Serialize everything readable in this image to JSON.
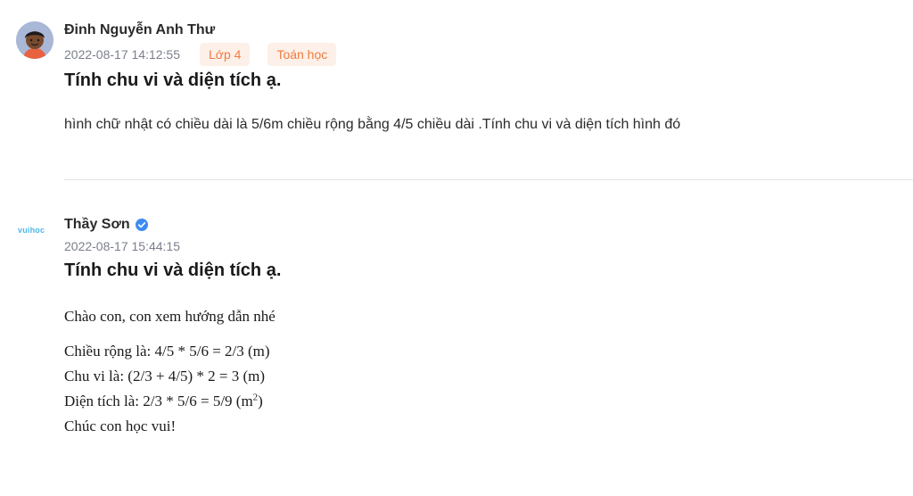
{
  "question": {
    "author": "Đinh Nguyễn Anh Thư",
    "timestamp": "2022-08-17 14:12:55",
    "tags": [
      "Lớp 4",
      "Toán học"
    ],
    "title": "Tính chu vi và diện tích ạ.",
    "body": "hình chữ nhật có chiều dài là 5/6m chiều rộng bằng 4/5 chiều dài .Tính chu vi và diện tích hình đó",
    "avatar_icon": "student-avatar-icon"
  },
  "answer": {
    "logo_text": "vuihoc",
    "author": "Thầy Sơn",
    "verified_icon": "verified-check-icon",
    "timestamp": "2022-08-17 15:44:15",
    "title": "Tính chu vi và diện tích ạ.",
    "greeting": "Chào con, con xem hướng dẫn nhé",
    "width_line": "Chiều rộng là: 4/5 * 5/6 = 2/3 (m)",
    "perimeter_line": "Chu vi là: (2/3 + 4/5) * 2 = 3 (m)",
    "area_line_prefix": "Diện tích là: 2/3 * 5/6 = 5/9 (m",
    "area_line_superscript": "2",
    "area_line_suffix": ")",
    "closing": "Chúc con học vui!"
  },
  "colors": {
    "tag_background": "#fdf0e8",
    "tag_text": "#f07b3f",
    "verified_blue": "#3d8bf2",
    "logo_blue": "#4db8e8",
    "meta_gray": "#7a7f8a"
  }
}
